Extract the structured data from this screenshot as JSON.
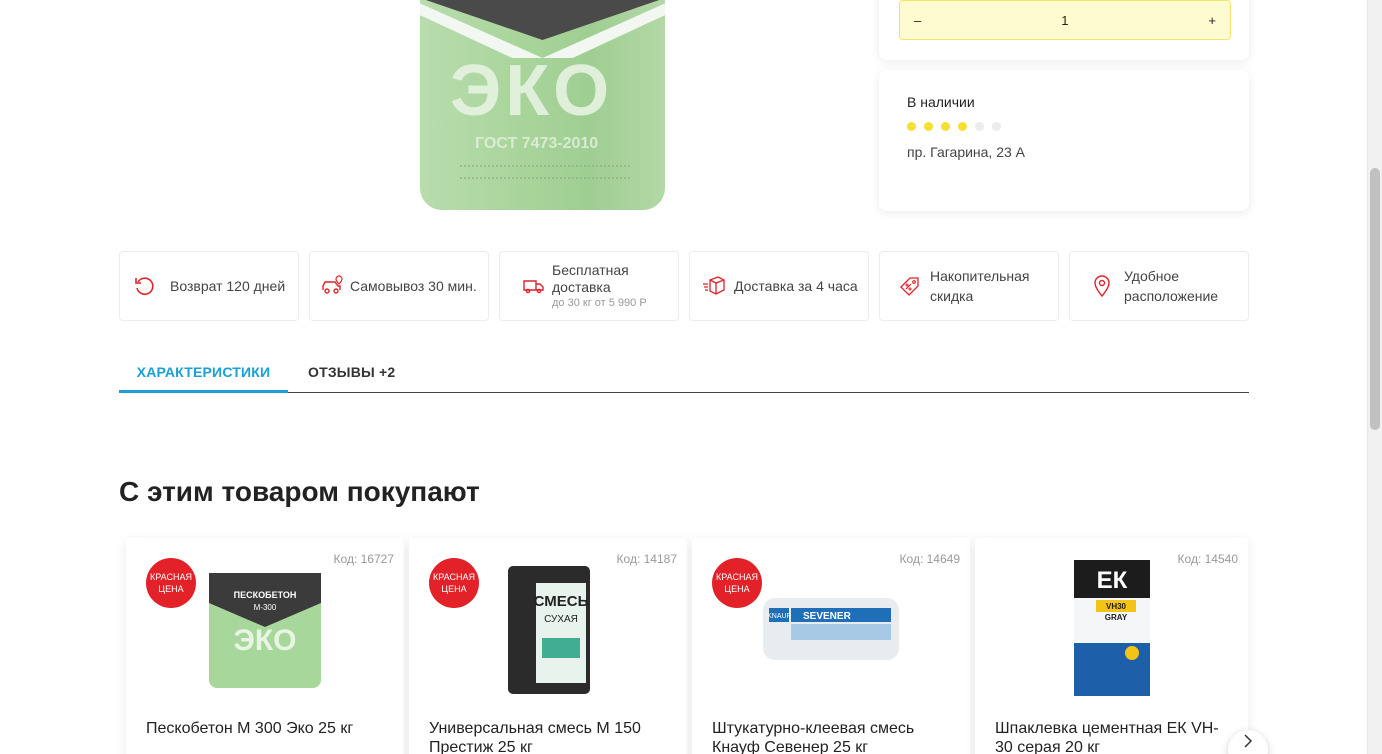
{
  "product": {
    "bag_brand": "ЭКО",
    "bag_standard": "ГОСТ 7473-2010"
  },
  "quantity": {
    "minus": "–",
    "value": "1",
    "plus": "+"
  },
  "stock": {
    "title": "В наличии",
    "level": 4,
    "level_max": 6,
    "address": "пр. Гагарина, 23 А"
  },
  "features": [
    {
      "icon": "return-icon",
      "label": "Возврат 120 дней"
    },
    {
      "icon": "car-pickup-icon",
      "label": "Самовывоз 30 мин."
    },
    {
      "icon": "truck-icon",
      "label": "Бесплатная доставка",
      "sub": "до 30 кг от 5 990 Р"
    },
    {
      "icon": "box-delivery-icon",
      "label": "Доставка за 4 часа"
    },
    {
      "icon": "discount-tag-icon",
      "label": "Накопительная скидка"
    },
    {
      "icon": "location-pin-icon",
      "label": "Удобное расположение"
    }
  ],
  "tabs": {
    "characteristics": "ХАРАКТЕРИСТИКИ",
    "reviews": "ОТЗЫВЫ +2"
  },
  "related": {
    "title": "С этим товаром покупают",
    "items": [
      {
        "badge": "Красная цена",
        "code": "Код: 16727",
        "name": "Пескобетон М 300 Эко 25 кг"
      },
      {
        "badge": "Красная цена",
        "code": "Код: 14187",
        "name": "Универсальная смесь М 150 Престиж 25 кг"
      },
      {
        "badge": "Красная цена",
        "code": "Код: 14649",
        "name": "Штукатурно-клеевая смесь Кнауф Севенер 25 кг"
      },
      {
        "badge": "",
        "code": "Код: 14540",
        "name": "Шпаклевка цементная ЕК VH-30 серая 20 кг"
      }
    ]
  },
  "colors": {
    "accent": "#1a9fd6",
    "badge": "#e22128",
    "stock_dot": "#f3e030",
    "icon_red": "#e22128"
  }
}
